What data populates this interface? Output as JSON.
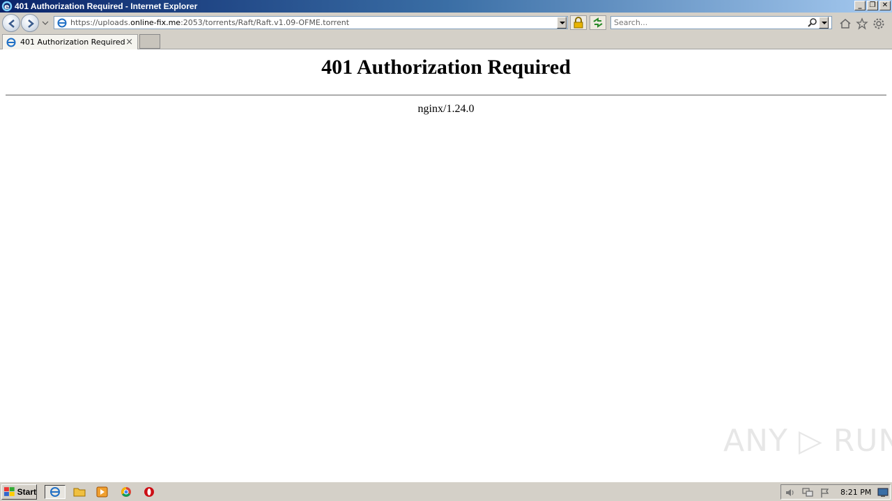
{
  "window": {
    "title": "401 Authorization Required - Internet Explorer",
    "min_glyph": "_",
    "max_glyph": "❐",
    "close_glyph": "✕"
  },
  "navbar": {
    "url_prefix": "https://uploads.",
    "url_domain": "online-fix.me",
    "url_suffix": ":2053/torrents/Raft/Raft.v1.09-OFME.torrent",
    "search_placeholder": "Search..."
  },
  "tab": {
    "label": "401 Authorization Required",
    "close_glyph": "×"
  },
  "page": {
    "heading": "401 Authorization Required",
    "server": "nginx/1.24.0"
  },
  "watermark": "ANY ▷ RUN",
  "taskbar": {
    "start_label": "Start",
    "clock": "8:21 PM"
  },
  "colors": {
    "title_start": "#0a246a",
    "title_end": "#a6caf0",
    "chrome": "#d4d0c8",
    "ie_blue": "#1f6fc5"
  }
}
